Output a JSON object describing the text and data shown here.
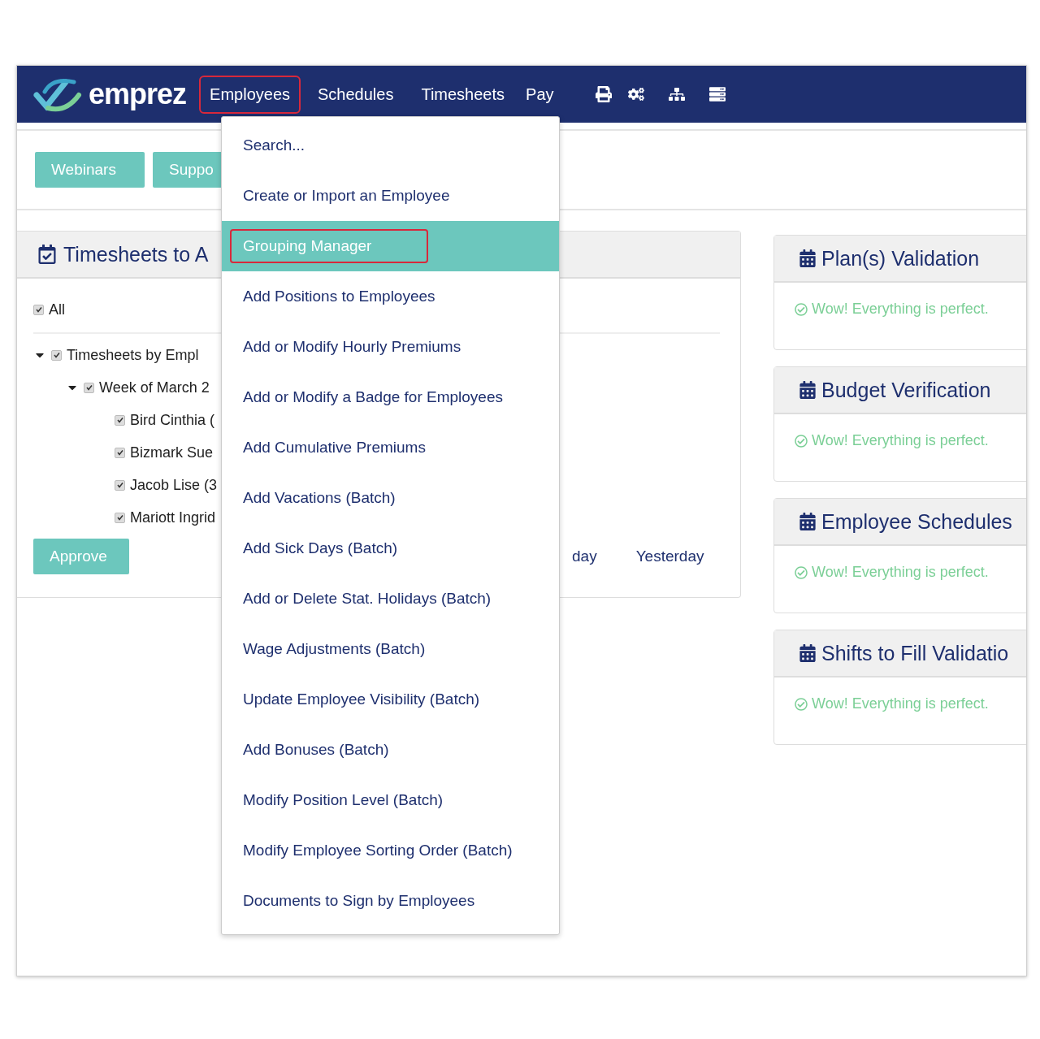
{
  "brand": {
    "name": "emprez"
  },
  "nav": [
    {
      "label": "Employees",
      "selected": true
    },
    {
      "label": "Schedules",
      "selected": false
    },
    {
      "label": "Timesheets",
      "selected": false
    },
    {
      "label": "Pay",
      "selected": false
    }
  ],
  "toolbar_icons": [
    {
      "kind": "print"
    },
    {
      "kind": "settings"
    },
    {
      "kind": "hierarchy"
    },
    {
      "kind": "server"
    }
  ],
  "quick_buttons": [
    "Webinars",
    "Suppo"
  ],
  "timesheets_panel": {
    "title": "Timesheets to A",
    "all": {
      "label": "All",
      "checked": true
    },
    "tree": [
      {
        "label": "Timesheets by Empl",
        "checked": true,
        "expanded": true,
        "children": [
          {
            "label": "Week of March 2",
            "checked": true,
            "expanded": true,
            "children": [
              {
                "label": "Bird Cinthia (",
                "checked": true
              },
              {
                "label": "Bizmark Sue",
                "checked": true
              },
              {
                "label": "Jacob Lise (3",
                "checked": true
              },
              {
                "label": "Mariott Ingrid",
                "checked": true
              }
            ]
          }
        ]
      }
    ],
    "approve_button": "Approve",
    "column_labels": [
      "day",
      "Yesterday"
    ]
  },
  "validation_panels": [
    {
      "title": "Plan(s) Validation",
      "message": "Wow! Everything is perfect."
    },
    {
      "title": "Budget Verification",
      "message": "Wow! Everything is perfect."
    },
    {
      "title": "Employee Schedules",
      "message": "Wow! Everything is perfect."
    },
    {
      "title": "Shifts to Fill Validatio",
      "message": "Wow! Everything is perfect."
    }
  ],
  "employees_menu": [
    {
      "label": "Search...",
      "selected": false
    },
    {
      "label": "Create or Import an Employee",
      "selected": false
    },
    {
      "label": "Grouping Manager",
      "selected": true
    },
    {
      "label": "Add Positions to Employees",
      "selected": false
    },
    {
      "label": "Add or Modify Hourly Premiums",
      "selected": false
    },
    {
      "label": "Add or Modify a Badge for Employees",
      "selected": false
    },
    {
      "label": "Add Cumulative Premiums",
      "selected": false
    },
    {
      "label": "Add Vacations (Batch)",
      "selected": false
    },
    {
      "label": "Add Sick Days (Batch)",
      "selected": false
    },
    {
      "label": "Add or Delete Stat. Holidays (Batch)",
      "selected": false
    },
    {
      "label": "Wage Adjustments (Batch)",
      "selected": false
    },
    {
      "label": "Update Employee Visibility (Batch)",
      "selected": false
    },
    {
      "label": "Add Bonuses (Batch)",
      "selected": false
    },
    {
      "label": "Modify Position Level (Batch)",
      "selected": false
    },
    {
      "label": "Modify Employee Sorting Order (Batch)",
      "selected": false
    },
    {
      "label": "Documents to Sign by Employees",
      "selected": false
    }
  ]
}
